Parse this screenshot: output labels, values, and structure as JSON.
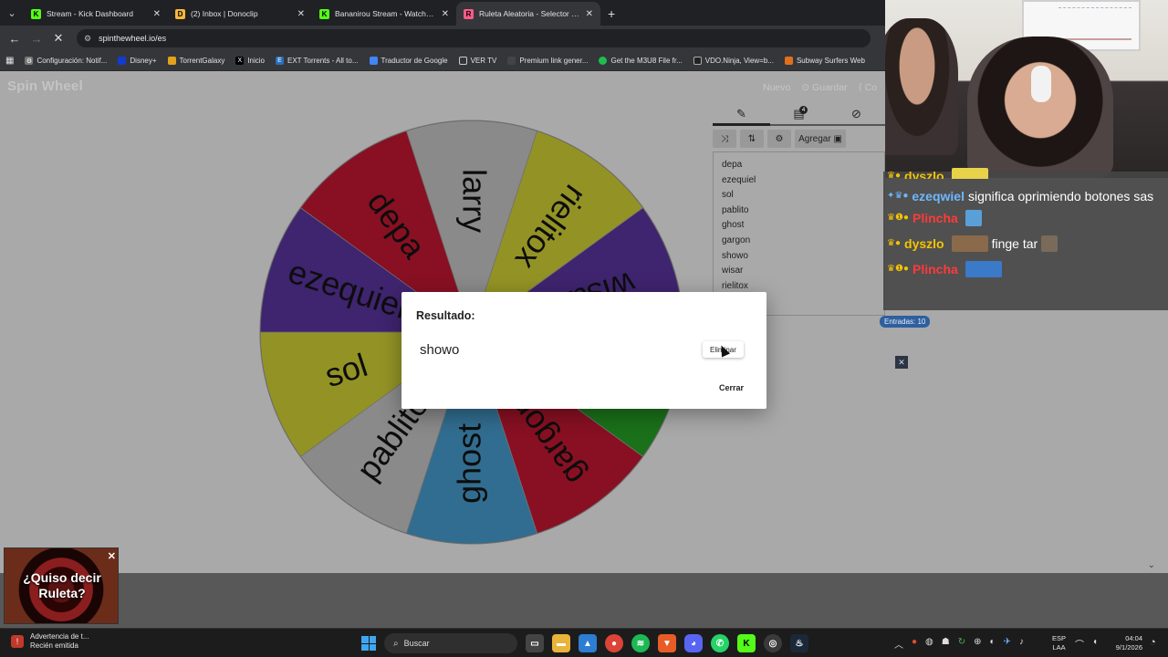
{
  "browser": {
    "tabs": [
      {
        "label": "Stream - Kick Dashboard",
        "fav_color": "#53fc18",
        "fav_char": "K"
      },
      {
        "label": "(2) Inbox | Donoclip",
        "fav_color": "#f5b83a",
        "fav_char": "D"
      },
      {
        "label": "Bananirou Stream - Watch Live",
        "fav_color": "#53fc18",
        "fav_char": "K"
      },
      {
        "label": "Ruleta Aleatoria - Selector Pers",
        "fav_color": "#ff5a8a",
        "fav_char": "R"
      }
    ],
    "url": "spinthewheel.io/es",
    "bookmarks": [
      {
        "label": "Configuración: Notif...",
        "icon": "gear-icon",
        "color": "#888"
      },
      {
        "label": "Disney+",
        "icon": "disney-icon",
        "color": "#113ccf"
      },
      {
        "label": "TorrentGalaxy",
        "icon": "galaxy-icon",
        "color": "#e3a21a"
      },
      {
        "label": "Inicio",
        "icon": "x-icon",
        "color": "#000"
      },
      {
        "label": "EXT Torrents - All to...",
        "icon": "ext-icon",
        "color": "#2a6ebb"
      },
      {
        "label": "Traductor de Google",
        "icon": "translate-icon",
        "color": "#4285f4"
      },
      {
        "label": "VER TV",
        "icon": "folder-icon",
        "color": "#888"
      },
      {
        "label": "Premium link gener...",
        "icon": "link-icon",
        "color": "#444"
      },
      {
        "label": "Get the M3U8 File fr...",
        "icon": "m3u8-icon",
        "color": "#1fbd4e"
      },
      {
        "label": "VDO.Ninja, View=b...",
        "icon": "ninja-icon",
        "color": "#222"
      },
      {
        "label": "Subway Surfers Web",
        "icon": "subway-icon",
        "color": "#e0701a"
      }
    ]
  },
  "app": {
    "logo": "Spin Wheel",
    "actions": [
      "Nuevo",
      "Guardar",
      "Co"
    ],
    "panel_tabs": [
      "edit-icon",
      "clipboard-icon",
      "hide-icon"
    ],
    "results_badge": "4",
    "tools": {
      "add_label": "Agregar"
    },
    "entries": [
      "depa",
      "ezequiel",
      "sol",
      "pablito",
      "ghost",
      "gargon",
      "showo",
      "wisar",
      "rielitox",
      "larry"
    ],
    "entries_count": "Entradas: 10"
  },
  "wheel": {
    "labels": [
      "larry",
      "rielitox",
      "wisar",
      "showo",
      "gargon",
      "ghost",
      "pablito",
      "sol",
      "ezequiel",
      "depa"
    ],
    "colors": [
      "#a9a9a9",
      "#b4b42e",
      "#4d2d88",
      "#208a20",
      "#a6142a",
      "#3c86b0",
      "#a9a9a9",
      "#b4b42e",
      "#4d2d88",
      "#a6142a"
    ]
  },
  "modal": {
    "title": "Resultado:",
    "result": "showo",
    "delete_label": "Eliminar",
    "close_label": "Cerrar"
  },
  "chat": [
    {
      "user": "dyszlo",
      "user_color": "#f5c400",
      "text": ""
    },
    {
      "user": "ezeqwiel",
      "user_color": "#6fb7ff",
      "text": "significa oprimiendo botones sas"
    },
    {
      "user": "Plincha",
      "user_color": "#ff3a3a",
      "text": ""
    },
    {
      "user": "dyszlo",
      "user_color": "#f5c400",
      "text": "finge tar"
    },
    {
      "user": "Plincha",
      "user_color": "#ff3a3a",
      "text": ""
    }
  ],
  "promo": {
    "text": "¿Quiso decir Ruleta?"
  },
  "taskbar": {
    "notif_title": "Advertencia de t...",
    "notif_sub": "Recién emitida",
    "search": "Buscar",
    "lang_top": "ESP",
    "lang_bottom": "LAA",
    "time": "04:04",
    "date": "9/1/2026"
  }
}
